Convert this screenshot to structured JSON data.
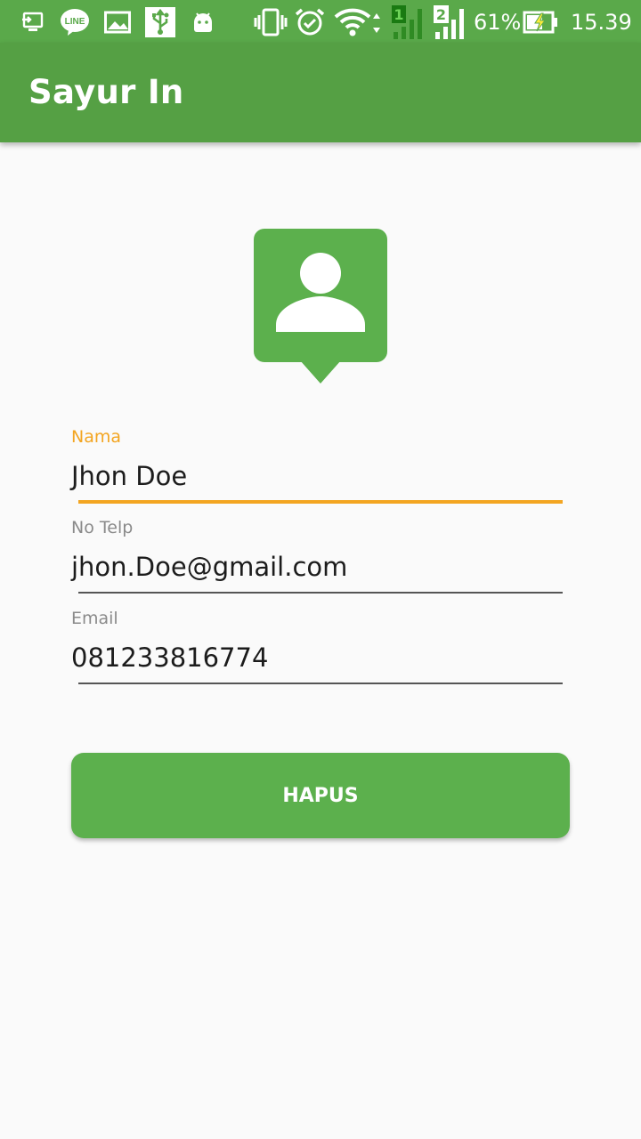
{
  "status_bar": {
    "battery_percent": "61%",
    "time": "15.39",
    "sim1_label": "1",
    "sim2_label": "2",
    "icons": [
      "cast-icon",
      "line-app-icon",
      "image-icon",
      "usb-icon",
      "android-debug-icon",
      "vibrate-icon",
      "alarm-icon",
      "wifi-icon",
      "signal-sim1-icon",
      "signal-sim2-icon",
      "battery-charging-icon"
    ],
    "line_badge": "LINE"
  },
  "app_bar": {
    "title": "Sayur In"
  },
  "avatar": {
    "icon": "contact-avatar-icon",
    "color": "#5cb04d"
  },
  "form": {
    "name": {
      "label": "Nama",
      "value": "Jhon Doe"
    },
    "phone": {
      "label": "No Telp",
      "value": "jhon.Doe@gmail.com"
    },
    "email": {
      "label": "Email",
      "value": "081233816774"
    }
  },
  "delete_button": {
    "label": "HAPUS"
  },
  "colors": {
    "primary": "#5cb04d",
    "primary_dark": "#5aa94a",
    "accent": "#f3a521",
    "background": "#fafafa"
  }
}
